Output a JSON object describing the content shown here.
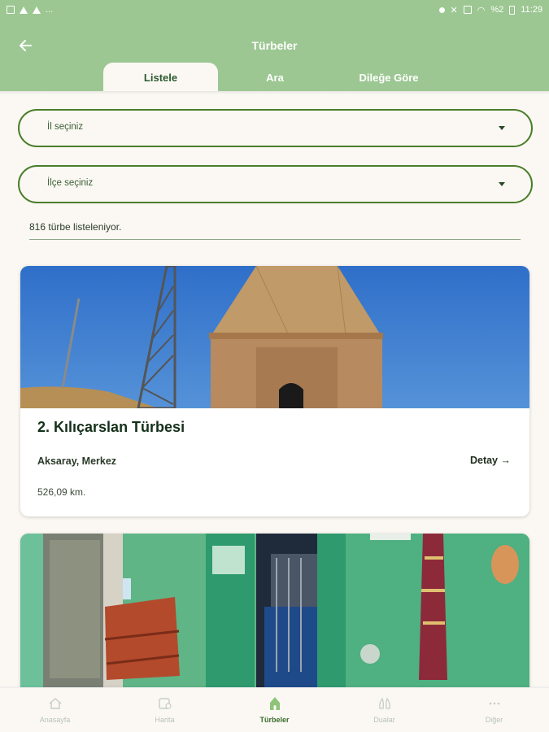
{
  "status_bar": {
    "battery": "%2",
    "time": "11:29"
  },
  "header": {
    "title": "Türbeler"
  },
  "tabs": [
    {
      "label": "Listele",
      "active": true
    },
    {
      "label": "Ara",
      "active": false
    },
    {
      "label": "Dileğe Göre",
      "active": false
    }
  ],
  "filters": {
    "province_placeholder": "İl seçiniz",
    "district_placeholder": "İlçe seçiniz"
  },
  "result_count": "816 türbe listeleniyor.",
  "cards": [
    {
      "name": "2. Kılıçarslan Türbesi",
      "location": "Aksaray, Merkez",
      "detail_label": "Detay",
      "distance": "526,09 km."
    }
  ],
  "bottom_nav": [
    {
      "label": "Anasayfa",
      "icon": "home-icon",
      "active": false
    },
    {
      "label": "Harita",
      "icon": "map-icon",
      "active": false
    },
    {
      "label": "Türbeler",
      "icon": "tomb-icon",
      "active": true
    },
    {
      "label": "Dualar",
      "icon": "prayer-hands-icon",
      "active": false
    },
    {
      "label": "Diğer",
      "icon": "more-icon",
      "active": false
    }
  ],
  "colors": {
    "primary": "#9cc792",
    "accent": "#4a7d2a",
    "background": "#fbf8f3"
  }
}
